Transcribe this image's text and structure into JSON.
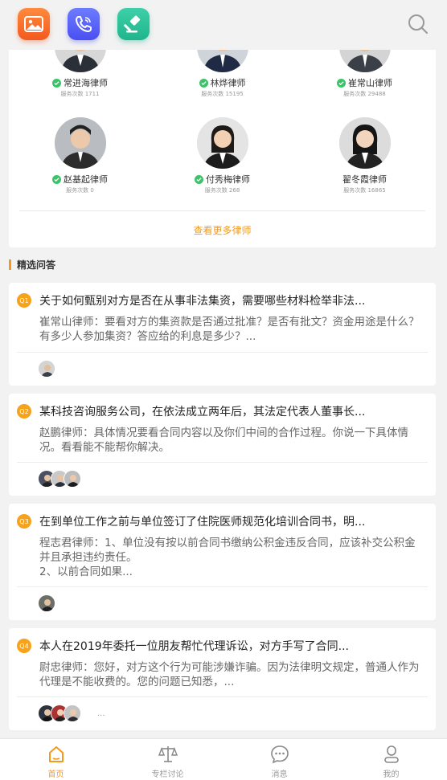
{
  "topbar": {
    "apps": [
      {
        "icon": "gallery-icon",
        "color": "#f35a1e"
      },
      {
        "icon": "phone-icon",
        "color": "#4a4ff0"
      },
      {
        "icon": "gavel-icon",
        "color": "#1fb58c"
      }
    ],
    "search_icon": "search-icon"
  },
  "lawyers": [
    {
      "name": "常进海律师",
      "count": "服务次数 1711",
      "verified": true
    },
    {
      "name": "林烨律师",
      "count": "服务次数 15195",
      "verified": true
    },
    {
      "name": "崔常山律师",
      "count": "服务次数 29488",
      "verified": true
    },
    {
      "name": "赵基起律师",
      "count": "服务次数 0",
      "verified": true
    },
    {
      "name": "付秀梅律师",
      "count": "服务次数 268",
      "verified": true
    },
    {
      "name": "翟冬霞律师",
      "count": "服务次数 16865",
      "verified": false
    }
  ],
  "more_lawyers": "查看更多律师",
  "section_title": "精选问答",
  "questions": [
    {
      "badge": "Q1",
      "title": "关于如何甄别对方是否在从事非法集资，需要哪些材料检举非法...",
      "answer": "崔常山律师：要看对方的集资款是否通过批准？是否有批文？资金用途是什么？有多少人参加集资？答应给的利息是多少？...",
      "dots": ""
    },
    {
      "badge": "Q2",
      "title": "某科技咨询服务公司，在依法成立两年后，其法定代表人董事长...",
      "answer": "赵鹏律师：具体情况要看合同内容以及你们中间的合作过程。你说一下具体情况。看看能不能帮你解决。",
      "dots": ""
    },
    {
      "badge": "Q3",
      "title": "在到单位工作之前与单位签订了住院医师规范化培训合同书，明...",
      "answer": "程志君律师：1、单位没有按以前合同书缴纳公积金违反合同，应该补交公积金并且承担违约责任。\n2、以前合同如果...",
      "dots": ""
    },
    {
      "badge": "Q4",
      "title": "本人在2019年委托一位朋友帮忙代理诉讼，对方手写了合同...",
      "answer": "尉忠律师：您好，对方这个行为可能涉嫌诈骗。因为法律明文规定，普通人作为代理是不能收费的。您的问题已知悉，...",
      "dots": "..."
    }
  ],
  "bottom_nav": [
    {
      "label": "首页",
      "icon": "home-icon",
      "active": true
    },
    {
      "label": "专栏讨论",
      "icon": "scale-icon",
      "active": false
    },
    {
      "label": "消息",
      "icon": "chat-icon",
      "active": false
    },
    {
      "label": "我的",
      "icon": "user-icon",
      "active": false
    }
  ],
  "colors": {
    "accent": "#f39a1c",
    "verified": "#3cc268"
  }
}
